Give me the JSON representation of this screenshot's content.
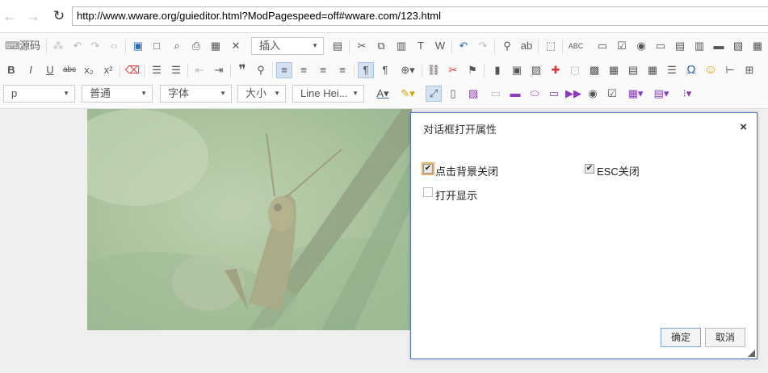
{
  "browser": {
    "back_icon": "←",
    "forward_icon": "→",
    "reload_icon": "↻",
    "url": "http://www.wware.org/guieditor.html?ModPagespeed=off#wware.com/123.html"
  },
  "toolbar": {
    "source_label": "源码",
    "insert_label": "插入",
    "row3": {
      "paragraph": "p",
      "style": "普通",
      "font": "字体",
      "size": "大小",
      "line_height": "Line Hei..."
    },
    "glyphs": {
      "bold": "B",
      "italic": "I",
      "underline": "U",
      "strike": "abc",
      "subscript": "x₂",
      "superscript": "x²",
      "quote": "❞",
      "omega": "Ω",
      "spell": "ABC",
      "smiley": "☺"
    }
  },
  "dialog": {
    "title": "对话框打开属性",
    "close_glyph": "×",
    "options": [
      {
        "label": "点击背景关闭",
        "checked": true
      },
      {
        "label": "ESC关闭",
        "checked": true
      },
      {
        "label": "打开显示",
        "checked": false
      }
    ],
    "ok_label": "确定",
    "cancel_label": "取消"
  },
  "colors": {
    "dialog_border": "#4a78c2",
    "accent_blue": "#2b6cb0",
    "accent_red": "#d33333"
  }
}
